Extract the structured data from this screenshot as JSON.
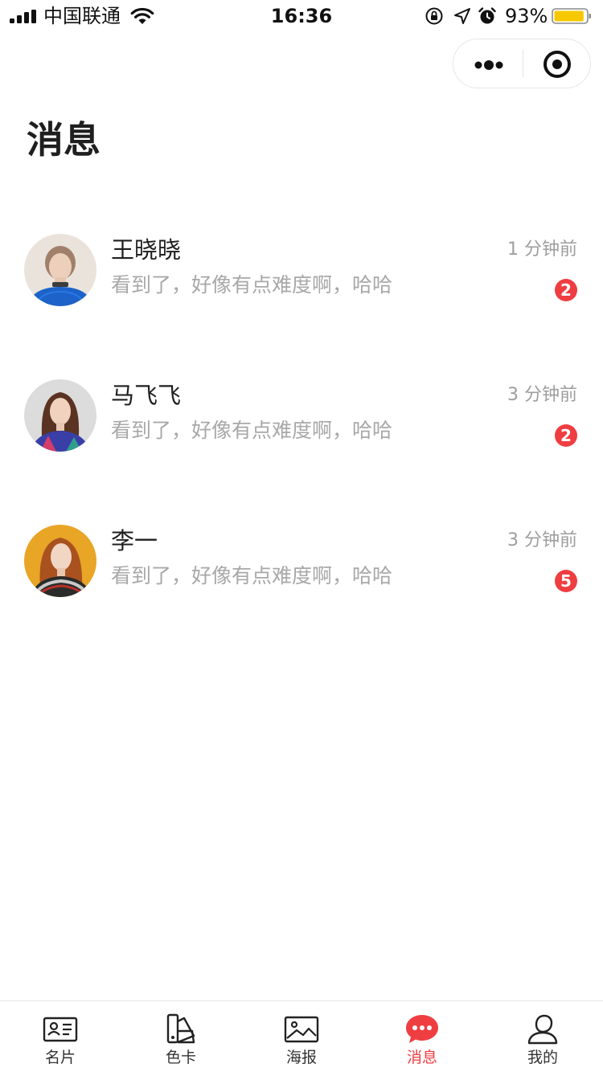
{
  "status_bar": {
    "carrier": "中国联通",
    "time": "16:36",
    "battery_percent": "93%",
    "battery_level": 0.93,
    "battery_color": "#f7c800"
  },
  "capsule": {
    "more_icon": "more-dots-icon",
    "close_icon": "target-circle-icon"
  },
  "page": {
    "title": "消息"
  },
  "messages": [
    {
      "name": "王晓晓",
      "preview": "看到了，好像有点难度啊，哈哈",
      "time": "1 分钟前",
      "unread": "2"
    },
    {
      "name": "马飞飞",
      "preview": "看到了，好像有点难度啊，哈哈",
      "time": "3 分钟前",
      "unread": "2"
    },
    {
      "name": "李一",
      "preview": "看到了，好像有点难度啊，哈哈",
      "time": "3 分钟前",
      "unread": "5"
    }
  ],
  "tab_bar": {
    "active_color": "#ef3e42",
    "items": [
      {
        "label": "名片",
        "icon": "business-card-icon"
      },
      {
        "label": "色卡",
        "icon": "color-swatch-icon"
      },
      {
        "label": "海报",
        "icon": "image-poster-icon"
      },
      {
        "label": "消息",
        "icon": "chat-bubble-icon",
        "active": true
      },
      {
        "label": "我的",
        "icon": "user-profile-icon"
      }
    ]
  },
  "colors": {
    "badge": "#ef3e42",
    "muted_text": "#a8a8a8"
  }
}
